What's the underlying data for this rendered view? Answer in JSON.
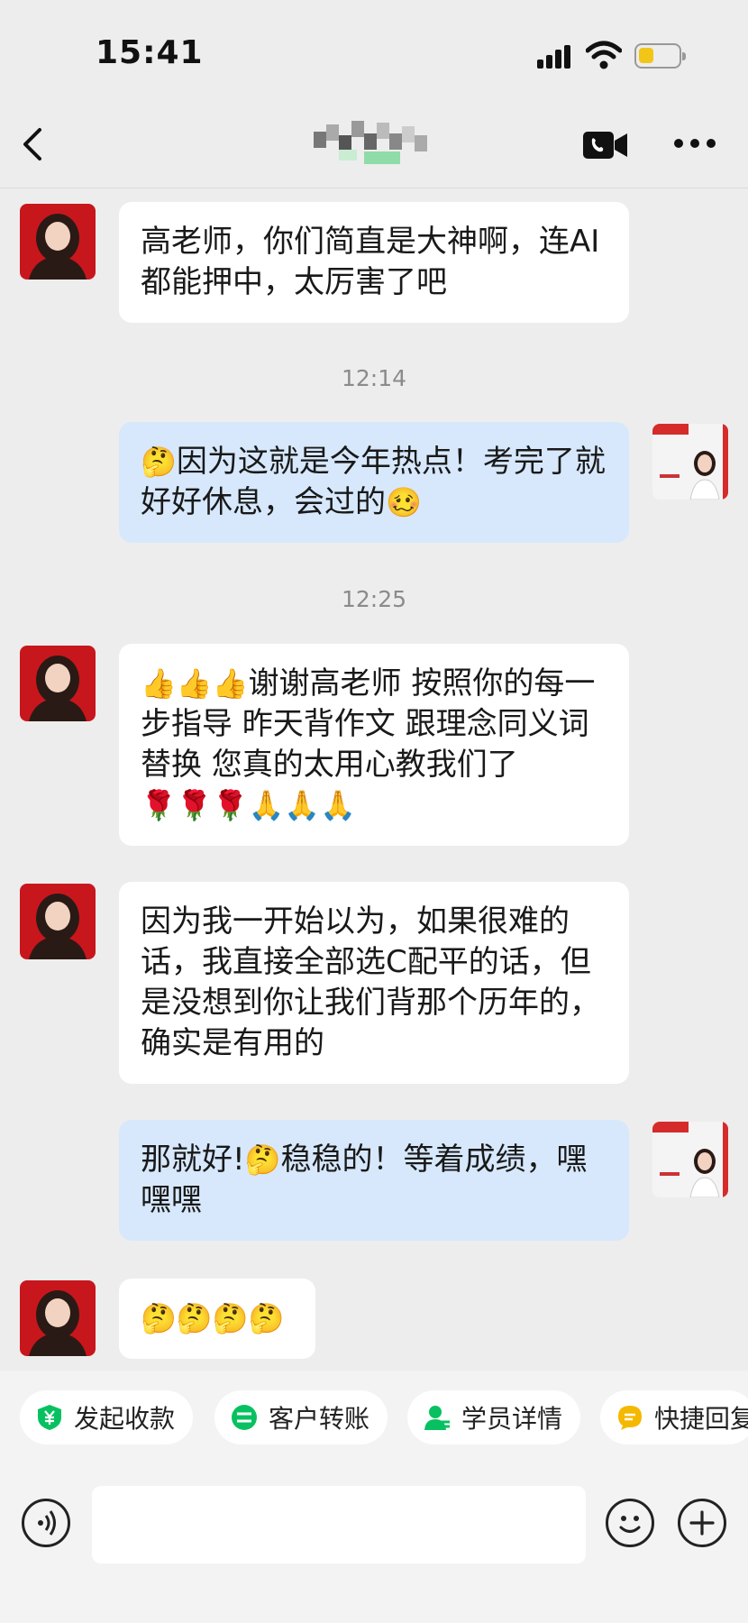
{
  "status_bar": {
    "time": "15:41"
  },
  "chat": {
    "messages": [
      {
        "side": "in",
        "text": "高老师，你们简直是大神啊，连AI都能押中，太厉害了吧"
      },
      {
        "type": "time",
        "text": "12:14"
      },
      {
        "side": "out",
        "emoji_lead": "🤔",
        "text": "因为这就是今年热点！考完了就好好休息，会过的",
        "emoji_tail": "🥴"
      },
      {
        "type": "time",
        "text": "12:25"
      },
      {
        "side": "in",
        "emoji_lead": "👍👍👍",
        "text": "谢谢高老师 按照你的每一步指导 昨天背作文 跟理念同义词替换 您真的太用心教我们了",
        "emoji_tail": "🌹🌹🌹🙏🙏🙏"
      },
      {
        "side": "in",
        "text": "因为我一开始以为，如果很难的话，我直接全部选C配平的话，但是没想到你让我们背那个历年的，确实是有用的"
      },
      {
        "side": "out",
        "text_before": "那就好!",
        "emoji_mid": "🤔",
        "text_after": "稳稳的！等着成绩，嘿嘿嘿"
      },
      {
        "side": "in",
        "emoji_only": "🤔🤔🤔🤔"
      }
    ]
  },
  "quick_actions": [
    {
      "label": "发起收款",
      "icon": "yuan-shield-icon",
      "color": "#07c160"
    },
    {
      "label": "客户转账",
      "icon": "transfer-icon",
      "color": "#07c160"
    },
    {
      "label": "学员详情",
      "icon": "person-icon",
      "color": "#07c160"
    },
    {
      "label": "快捷回复",
      "icon": "quick-reply-icon",
      "color": "#f5b800"
    }
  ],
  "colors": {
    "incoming_bubble": "#ffffff",
    "outgoing_bubble": "#d7e8fc",
    "background": "#ededed",
    "accent_green": "#07c160"
  }
}
